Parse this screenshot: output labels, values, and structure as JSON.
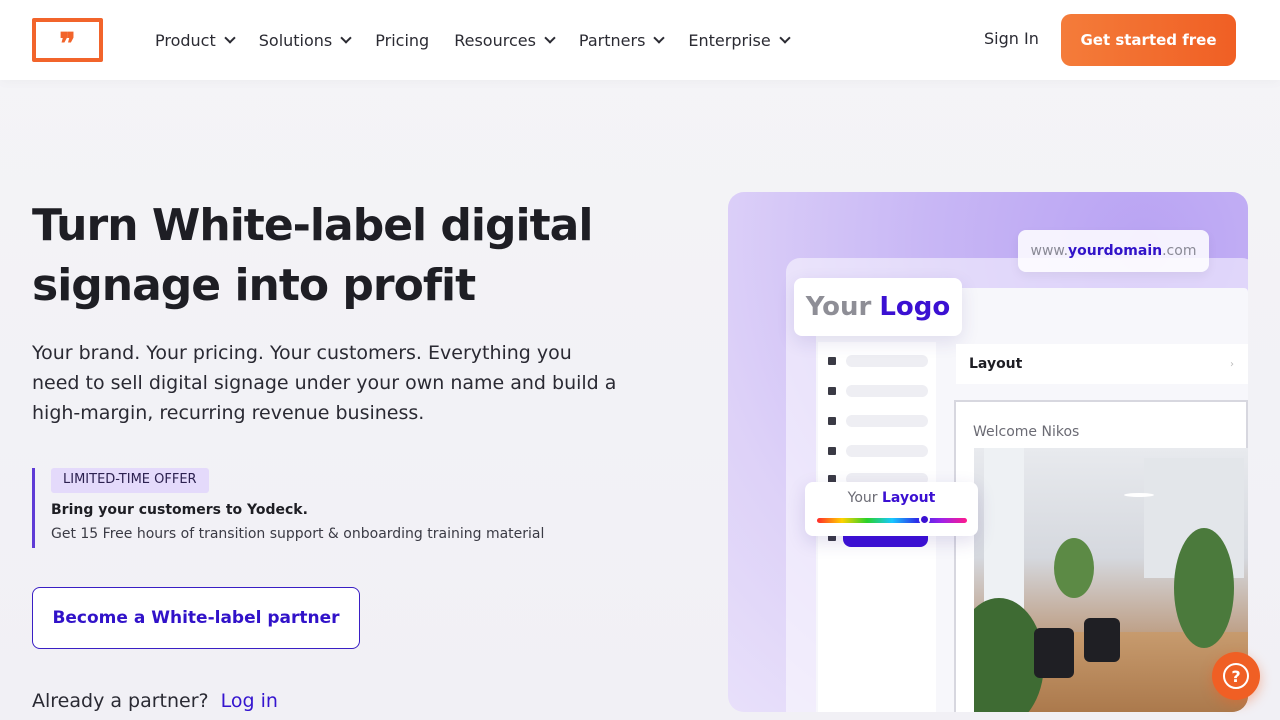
{
  "nav": {
    "logo_glyph": "❞",
    "items": [
      {
        "label": "Product",
        "dropdown": true
      },
      {
        "label": "Solutions",
        "dropdown": true
      },
      {
        "label": "Pricing",
        "dropdown": false
      },
      {
        "label": "Resources",
        "dropdown": true
      },
      {
        "label": "Partners",
        "dropdown": true
      },
      {
        "label": "Enterprise",
        "dropdown": true
      }
    ],
    "signin": "Sign In",
    "cta": "Get started free"
  },
  "hero": {
    "headline_1": "Turn White-label digital",
    "headline_2": "signage into profit",
    "lead": "Your brand. Your pricing. Your customers. Everything you need to sell digital signage under your own name and build a high-margin, recurring revenue business.",
    "offer": {
      "badge": "LIMITED-TIME OFFER",
      "title": "Bring your customers to Yodeck.",
      "desc": "Get 15 Free hours of transition support & onboarding training material"
    },
    "partner_button": "Become a White-label partner",
    "already": "Already a partner?",
    "login": "Log in"
  },
  "visual": {
    "domain_pre": "www.",
    "domain_main": "yourdomain",
    "domain_post": ".com",
    "logo_your": "Your",
    "logo_word": "Logo",
    "layout_label": "Layout",
    "layout_arrow": "›",
    "welcome": "Welcome Nikos",
    "color_your": "Your",
    "color_word": "Layout"
  },
  "help_icon": "?",
  "colors": {
    "accent": "#f05f24",
    "brand_purple": "#3b10d2",
    "badge_bg": "#e4dafb"
  }
}
